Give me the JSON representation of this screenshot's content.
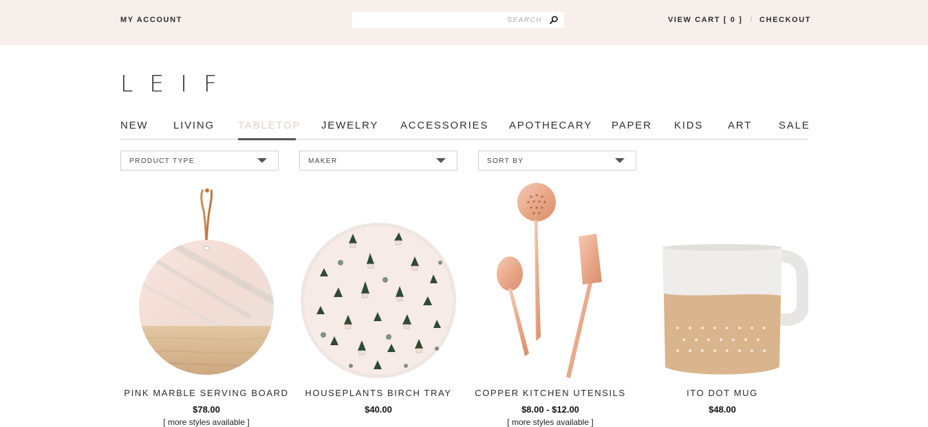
{
  "header": {
    "my_account": "MY ACCOUNT",
    "search_placeholder": "SEARCH",
    "view_cart": "VIEW CART [ 0 ]",
    "separator": "/",
    "checkout": "CHECKOUT"
  },
  "logo": "LEIF",
  "nav": {
    "items": [
      {
        "label": "NEW"
      },
      {
        "label": "LIVING"
      },
      {
        "label": "TABLETOP",
        "active": true
      },
      {
        "label": "JEWELRY"
      },
      {
        "label": "ACCESSORIES"
      },
      {
        "label": "APOTHECARY"
      },
      {
        "label": "PAPER"
      },
      {
        "label": "KIDS"
      },
      {
        "label": "ART"
      },
      {
        "label": "SALE"
      }
    ]
  },
  "filters": [
    {
      "label": "PRODUCT TYPE"
    },
    {
      "label": "MAKER"
    },
    {
      "label": "SORT BY"
    }
  ],
  "products": [
    {
      "name": "PINK MARBLE SERVING BOARD",
      "price": "$78.00",
      "more": "[ more styles available ]",
      "image": "marble-board-icon"
    },
    {
      "name": "HOUSEPLANTS BIRCH TRAY",
      "price": "$40.00",
      "more": "",
      "image": "plant-tray-icon"
    },
    {
      "name": "COPPER KITCHEN UTENSILS",
      "price": "$8.00 - $12.00",
      "more": "[ more styles available ]",
      "image": "copper-utensils-icon"
    },
    {
      "name": "ITO DOT MUG",
      "price": "$48.00",
      "more": "",
      "image": "mug-icon"
    }
  ],
  "colors": {
    "top_band": "#f7efeb",
    "active_nav": "#e0d2c8",
    "text": "#2b2b2b",
    "copper": "#e8a888"
  }
}
